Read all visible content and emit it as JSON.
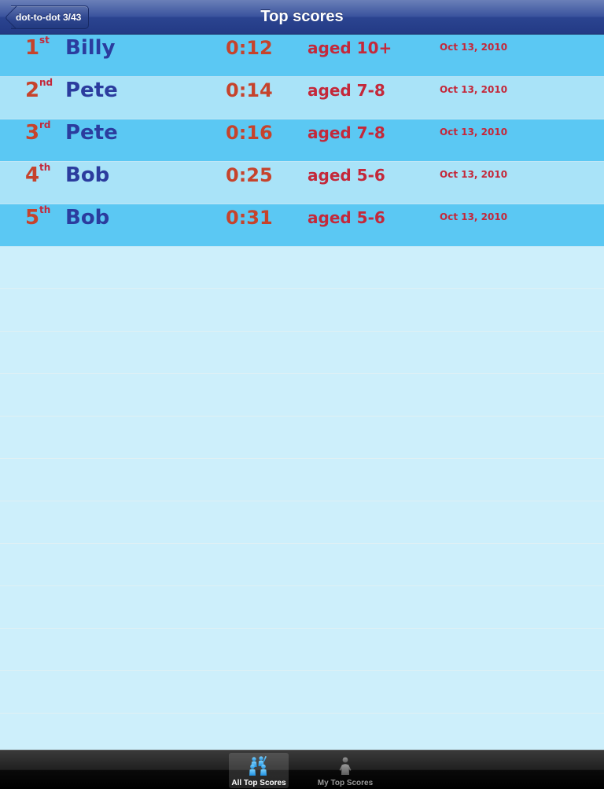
{
  "navbar": {
    "title": "Top scores",
    "back_label": "dot-to-dot 3/43"
  },
  "scores": [
    {
      "rank": "1",
      "suffix": "st",
      "name": "Billy",
      "time": "0:12",
      "age": "aged 10+",
      "date": "Oct 13, 2010"
    },
    {
      "rank": "2",
      "suffix": "nd",
      "name": "Pete",
      "time": "0:14",
      "age": "aged 7-8",
      "date": "Oct 13, 2010"
    },
    {
      "rank": "3",
      "suffix": "rd",
      "name": "Pete",
      "time": "0:16",
      "age": "aged 7-8",
      "date": "Oct 13, 2010"
    },
    {
      "rank": "4",
      "suffix": "th",
      "name": "Bob",
      "time": "0:25",
      "age": "aged 5-6",
      "date": "Oct 13, 2010"
    },
    {
      "rank": "5",
      "suffix": "th",
      "name": "Bob",
      "time": "0:31",
      "age": "aged 5-6",
      "date": "Oct 13, 2010"
    }
  ],
  "tabbar": {
    "all_label": "All Top Scores",
    "my_label": "My Top Scores",
    "all_icon": "group-people-icon",
    "my_icon": "person-icon",
    "selected_tab": "All Top Scores"
  },
  "colors": {
    "row_dark": "#5bc8f3",
    "row_light": "#a9e3f8",
    "empty_row": "#cdeffb",
    "name_text": "#2b3c9e",
    "rank_time_text": "#c6432c",
    "age_date_text": "#c4283a",
    "navbar": "#2b4490"
  }
}
